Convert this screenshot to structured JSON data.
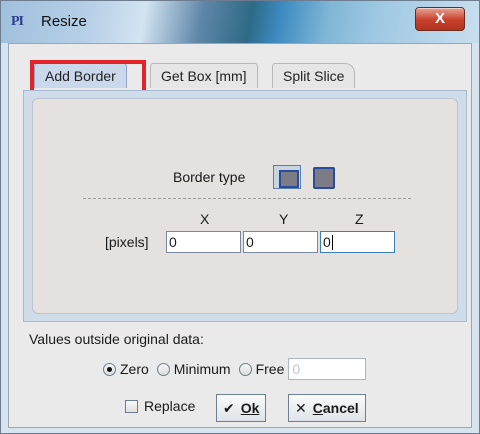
{
  "window": {
    "title": "Resize",
    "app_icon": "PI",
    "close_glyph": "X"
  },
  "tabs": [
    {
      "label": "Add Border",
      "active": true
    },
    {
      "label": "Get Box [mm]",
      "active": false
    },
    {
      "label": "Split Slice",
      "active": false
    }
  ],
  "border": {
    "label": "Border type",
    "options": [
      {
        "icon": "border-inset-icon",
        "selected": true
      },
      {
        "icon": "border-outset-icon",
        "selected": false
      }
    ]
  },
  "axes": {
    "x_label": "X",
    "y_label": "Y",
    "z_label": "Z",
    "unit_label": "[pixels]",
    "x_value": "0",
    "y_value": "0",
    "z_value": "0"
  },
  "values_outside": {
    "label": "Values outside original data:",
    "options": [
      "Zero",
      "Minimum",
      "Free"
    ],
    "selected": "Zero",
    "free_value": "0"
  },
  "footer": {
    "replace_label": "Replace",
    "replace_checked": false,
    "ok_icon": "✔",
    "ok_label": "Ok",
    "cancel_icon": "✕",
    "cancel_label": "Cancel"
  },
  "colors": {
    "highlight": "#e0242a",
    "active_tab": "#c9d8ea",
    "close_button": "#c7402b"
  }
}
